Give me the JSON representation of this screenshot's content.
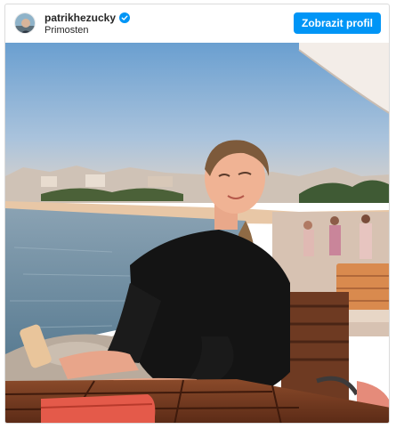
{
  "post": {
    "username": "patrikhezucky",
    "verified": true,
    "location": "Primosten",
    "profile_button_label": "Zobrazit profil"
  },
  "icons": {
    "verified": "verified-badge-icon",
    "avatar": "avatar"
  },
  "colors": {
    "accent": "#0095f6",
    "border": "#dbdbdb"
  }
}
